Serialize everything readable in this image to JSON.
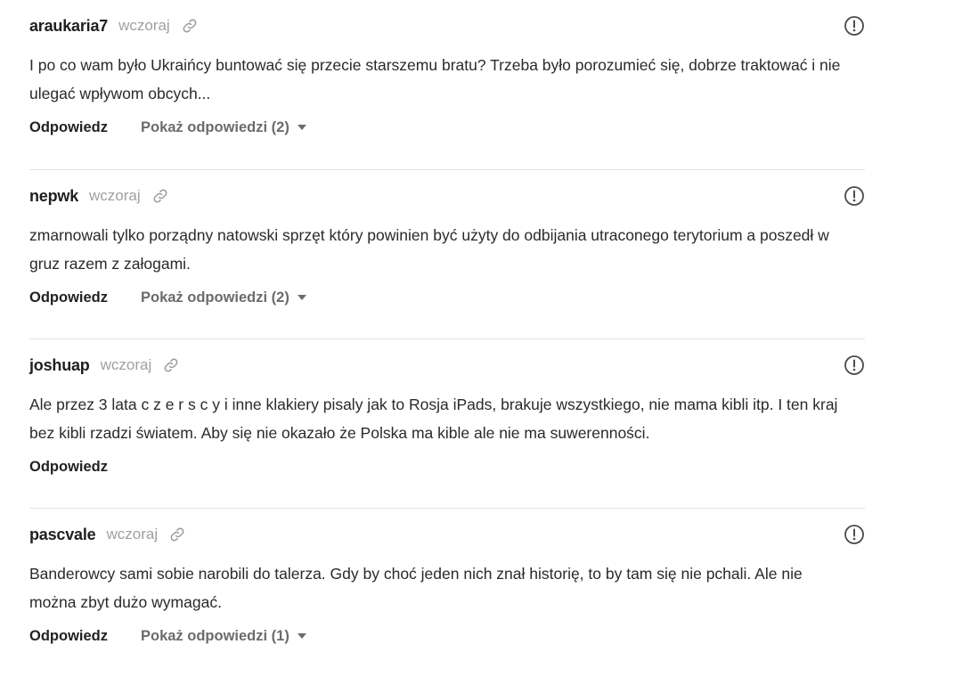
{
  "icons": {
    "link": "link-icon",
    "report": "exclamation-circle-icon",
    "caret": "caret-down-icon"
  },
  "colors": {
    "author": "#1f1f1f",
    "timestamp": "#a0a0a0",
    "text": "#2a2a2a",
    "muted": "#6b6b6b",
    "divider": "#e3e3e3"
  },
  "comments": [
    {
      "author": "araukaria7",
      "time": "wczoraj",
      "text": "I po co wam było Ukraińcy buntować się przecie starszemu bratu? Trzeba było porozumieć się, dobrze traktować i nie ulegać wpływom obcych...",
      "reply_label": "Odpowiedz",
      "show_replies_label": "Pokaż odpowiedzi (2)"
    },
    {
      "author": "nepwk",
      "time": "wczoraj",
      "text": "zmarnowali tylko porządny natowski sprzęt który powinien być użyty do odbijania utraconego terytorium a poszedł w gruz razem z załogami.",
      "reply_label": "Odpowiedz",
      "show_replies_label": "Pokaż odpowiedzi (2)"
    },
    {
      "author": "joshuap",
      "time": "wczoraj",
      "text": "Ale przez 3 lata c z e r s c y i inne klakiery pisaly jak to Rosja iPads, brakuje wszystkiego, nie mama kibli itp. I ten kraj bez kibli rzadzi światem. Aby się nie okazało że Polska ma kible ale nie ma suwerenności.",
      "reply_label": "Odpowiedz",
      "show_replies_label": ""
    },
    {
      "author": "pascvale",
      "time": "wczoraj",
      "text": "Banderowcy sami sobie narobili do talerza. Gdy by choć jeden nich znał historię, to by tam się nie pchali. Ale nie można zbyt dużo wymagać.",
      "reply_label": "Odpowiedz",
      "show_replies_label": "Pokaż odpowiedzi (1)"
    }
  ]
}
